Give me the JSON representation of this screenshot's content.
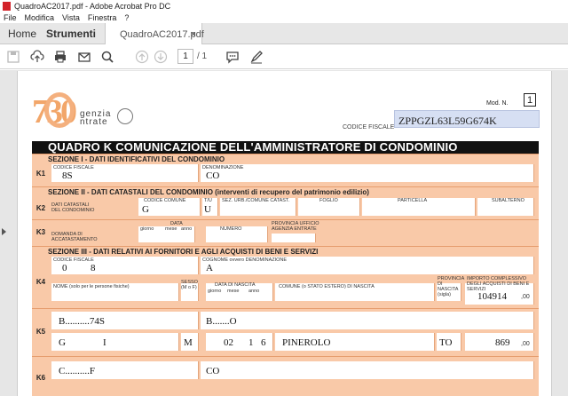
{
  "window": {
    "title": "QuadroAC2017.pdf - Adobe Acrobat Pro DC"
  },
  "menu": [
    "File",
    "Modifica",
    "Vista",
    "Finestra",
    "?"
  ],
  "tabs": {
    "home": "Home",
    "tools": "Strumenti",
    "document": "QuadroAC2017.pdf",
    "close": "×"
  },
  "toolbar": {
    "icons": [
      "save-icon",
      "upload-icon",
      "print-icon",
      "email-icon",
      "search-icon",
      "prev-page-icon",
      "next-page-icon",
      "comment-icon",
      "sign-icon"
    ],
    "page_current": "1",
    "page_total": "/ 1"
  },
  "doc": {
    "logo_number": "730",
    "agency_line1": "genzia",
    "agency_line2": "ntrate",
    "mod_label": "Mod. N.",
    "mod_value": "1",
    "cf_label": "CODICE FISCALE",
    "cf_value": "ZPPGZL63L59G674K",
    "quadro_title": "QUADRO  K  COMUNICAZIONE DELL'AMMINISTRATORE DI CONDOMINIO",
    "sezione1": "SEZIONE I  -  DATI IDENTIFICATIVI DEL CONDOMINIO",
    "sezione2": "SEZIONE II  -  DATI CATASTALI DEL CONDOMINIO (interventi di recupero del patrimonio edilizio)",
    "sezione3": "SEZIONE III  -  DATI RELATIVI AI FORNITORI E AGLI ACQUISTI DI BENI E SERVIZI",
    "k1": {
      "label": "K1",
      "cf_cap": "CODICE FISCALE",
      "cf_val": "8S",
      "den_cap": "DENOMINAZIONE",
      "den_val": "CO"
    },
    "k2": {
      "label": "K2",
      "desc": "DATI CATASTALI DEL CONDOMINIO",
      "caps": [
        "CODICE COMUNE",
        "T/U",
        "SEZ. URB./COMUNE CATAST.",
        "FOGLIO",
        "PARTICELLA",
        "SUBALTERNO"
      ],
      "vals": [
        "G",
        "U"
      ]
    },
    "k3": {
      "label": "K3",
      "desc": "DOMANDA DI ACCATASTAMENTO",
      "caps": [
        "DATA",
        "giorno",
        "mese",
        "anno",
        "NUMERO",
        "PROVINCIA UFFICIO AGENZIA ENTRATE"
      ]
    },
    "k4": {
      "label": "K4",
      "cf_cap": "CODICE FISCALE",
      "cf_val1": "0",
      "cf_val2": "8",
      "cog_cap": "COGNOME ovvero DENOMINAZIONE",
      "cog_val": "A",
      "nome_cap": "NOME (solo per le persone fisiche)",
      "sesso_cap": "SESSO (M o F)",
      "nasc_cap": "DATA DI NASCITA",
      "nasc_sub": [
        "giorno",
        "mese",
        "anno"
      ],
      "comune_cap": "COMUNE (o STATO ESTERO) DI NASCITA",
      "prov_cap": "PROVINCIA DI NASCITA (sigla)",
      "importo_cap": "IMPORTO COMPLESSIVO DEGLI ACQUISTI DI BENI E SERVIZI",
      "importo_val": "104914",
      "cents": ",00"
    },
    "k5": {
      "label": "K5",
      "cf_val": "B..........74S",
      "cog_val": "B.......O",
      "nome_val": "G",
      "nome_val2": "I",
      "sesso_val": "M",
      "nasc_val1": "02",
      "nasc_val2": "1",
      "nasc_val3": "6",
      "comune_val": "PINEROLO",
      "prov_val": "TO",
      "importo_val": "869",
      "cents": ",00"
    },
    "k6": {
      "label": "K6",
      "cf_val": "C..........F",
      "cog_val": "CO"
    }
  }
}
